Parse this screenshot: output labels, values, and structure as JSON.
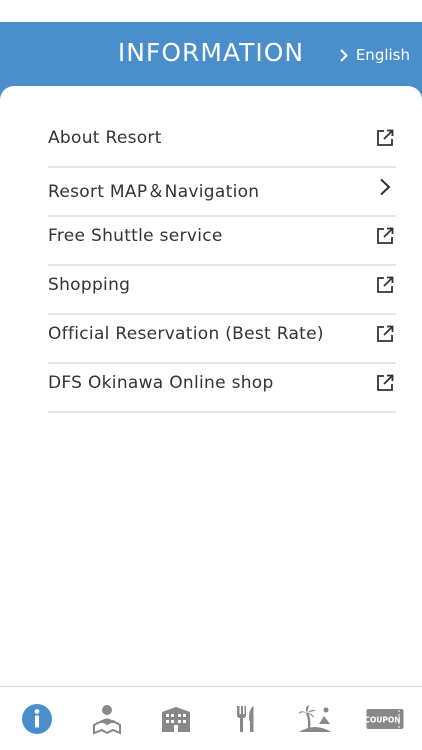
{
  "header": {
    "title": "INFORMATION",
    "lang_label": "English",
    "bg_color": "#4a8fcb"
  },
  "menu": {
    "items": [
      {
        "label": "About Resort",
        "icon": "external-link-icon"
      },
      {
        "label": "Resort MAP＆Navigation",
        "icon": "chevron-right-icon"
      },
      {
        "label": "Free Shuttle service",
        "icon": "external-link-icon"
      },
      {
        "label": "Shopping",
        "icon": "external-link-icon"
      },
      {
        "label": "Official Reservation (Best Rate)",
        "icon": "external-link-icon"
      },
      {
        "label": "DFS Okinawa Online shop",
        "icon": "external-link-icon"
      }
    ]
  },
  "tabbar": {
    "tabs": [
      {
        "icon": "info-icon",
        "active": true
      },
      {
        "icon": "map-icon"
      },
      {
        "icon": "hotel-icon"
      },
      {
        "icon": "restaurant-icon"
      },
      {
        "icon": "beach-icon"
      },
      {
        "icon": "coupon-icon",
        "label": "COUPON"
      }
    ],
    "active_color": "#4a8fcb",
    "inactive_color": "#888888"
  }
}
